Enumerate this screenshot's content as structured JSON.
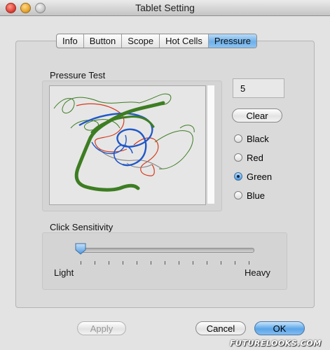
{
  "window": {
    "title": "Tablet Setting"
  },
  "tabs": [
    {
      "label": "Info"
    },
    {
      "label": "Button"
    },
    {
      "label": "Scope"
    },
    {
      "label": "Hot Cells"
    },
    {
      "label": "Pressure"
    }
  ],
  "active_tab": "Pressure",
  "pressure_test": {
    "label": "Pressure Test",
    "value": "5",
    "clear_label": "Clear"
  },
  "colors": {
    "options": [
      {
        "label": "Black",
        "hex": "#000000",
        "selected": false
      },
      {
        "label": "Red",
        "hex": "#d63a1c",
        "selected": false
      },
      {
        "label": "Green",
        "hex": "#3d7d22",
        "selected": true
      },
      {
        "label": "Blue",
        "hex": "#2058c8",
        "selected": false
      }
    ]
  },
  "click_sensitivity": {
    "label": "Click Sensitivity",
    "min_label": "Light",
    "max_label": "Heavy",
    "tick_count": 13,
    "value_fraction": 0.0
  },
  "footer": {
    "apply_label": "Apply",
    "cancel_label": "Cancel",
    "ok_label": "OK"
  },
  "watermark": {
    "text": "FUTURELOOKS.COM"
  }
}
